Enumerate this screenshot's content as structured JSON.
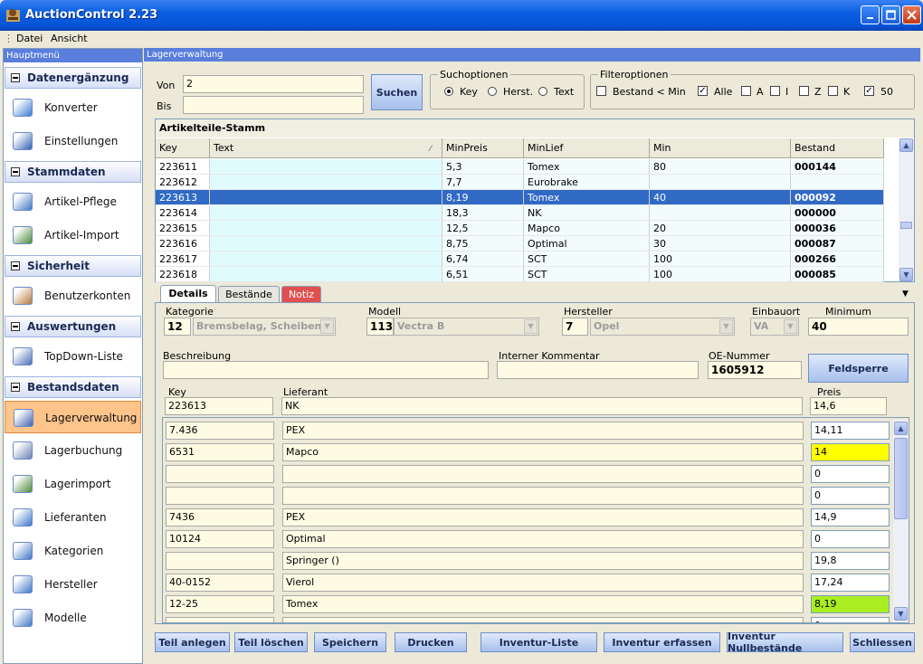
{
  "window": {
    "title": "AuctionControl 2.23"
  },
  "menu": [
    "Datei",
    "Ansicht"
  ],
  "sidebar": {
    "header": "Hauptmenü",
    "sections": [
      {
        "label": "Datenergänzung",
        "items": [
          {
            "label": "Konverter",
            "icon": "converter-icon"
          },
          {
            "label": "Einstellungen",
            "icon": "settings-icon"
          }
        ]
      },
      {
        "label": "Stammdaten",
        "items": [
          {
            "label": "Artikel-Pflege",
            "icon": "article-care-icon"
          },
          {
            "label": "Artikel-Import",
            "icon": "article-import-icon"
          }
        ]
      },
      {
        "label": "Sicherheit",
        "items": [
          {
            "label": "Benutzerkonten",
            "icon": "users-icon"
          }
        ]
      },
      {
        "label": "Auswertungen",
        "items": [
          {
            "label": "TopDown-Liste",
            "icon": "chart-icon"
          }
        ]
      },
      {
        "label": "Bestandsdaten",
        "items": [
          {
            "label": "Lagerverwaltung",
            "icon": "warehouse-icon",
            "selected": true
          },
          {
            "label": "Lagerbuchung",
            "icon": "booking-icon"
          },
          {
            "label": "Lagerimport",
            "icon": "import-icon"
          },
          {
            "label": "Lieferanten",
            "icon": "suppliers-icon"
          },
          {
            "label": "Kategorien",
            "icon": "categories-icon"
          },
          {
            "label": "Hersteller",
            "icon": "manufacturers-icon"
          },
          {
            "label": "Modelle",
            "icon": "models-icon"
          }
        ]
      }
    ]
  },
  "panel": {
    "header": "Lagerverwaltung"
  },
  "search": {
    "von_label": "Von",
    "von_value": "2",
    "bis_label": "Bis",
    "bis_value": "",
    "button": "Suchen"
  },
  "suchoptionen": {
    "title": "Suchoptionen",
    "options": [
      "Key",
      "Herst.",
      "Text"
    ],
    "selected": "Key"
  },
  "filteroptionen": {
    "title": "Filteroptionen",
    "bestand_label": "Bestand < Min",
    "bestand_checked": false,
    "items": [
      {
        "label": "Alle",
        "checked": true
      },
      {
        "label": "A",
        "checked": false
      },
      {
        "label": "I",
        "checked": false
      },
      {
        "label": "Z",
        "checked": false
      },
      {
        "label": "K",
        "checked": false
      },
      {
        "label": "50",
        "checked": true
      }
    ]
  },
  "grid": {
    "title": "Artikelteile-Stamm",
    "columns": [
      "Key",
      "Text",
      "MinPreis",
      "MinLief",
      "Min",
      "Bestand"
    ],
    "rows": [
      [
        "223611",
        "",
        "5,3",
        "Tomex",
        "80",
        "000144"
      ],
      [
        "223612",
        "",
        "7,7",
        "Eurobrake",
        "",
        ""
      ],
      [
        "223613",
        "",
        "8,19",
        "Tomex",
        "40",
        "000092"
      ],
      [
        "223614",
        "",
        "18,3",
        "NK",
        "",
        "000000"
      ],
      [
        "223615",
        "",
        "12,5",
        "Mapco",
        "20",
        "000036"
      ],
      [
        "223616",
        "",
        "8,75",
        "Optimal",
        "30",
        "000087"
      ],
      [
        "223617",
        "",
        "6,74",
        "SCT",
        "100",
        "000266"
      ],
      [
        "223618",
        "",
        "6,51",
        "SCT",
        "100",
        "000085"
      ]
    ],
    "selected_row": 2
  },
  "tabs": [
    "Details",
    "Bestände",
    "Notiz"
  ],
  "details": {
    "kategorie_label": "Kategorie",
    "kategorie_num": "12",
    "kategorie_value": "Bremsbelag, Scheibenbr",
    "modell_label": "Modell",
    "modell_num": "113",
    "modell_value": "Vectra B",
    "hersteller_label": "Hersteller",
    "hersteller_num": "7",
    "hersteller_value": "Opel",
    "einbauort_label": "Einbauort",
    "einbauort_value": "VA",
    "minimum_label": "Minimum",
    "minimum_value": "40",
    "beschreibung_label": "Beschreibung",
    "beschreibung_value": "",
    "kommentar_label": "Interner Kommentar",
    "kommentar_value": "",
    "oe_label": "OE-Nummer",
    "oe_value": "1605912",
    "feldsperre": "Feldsperre",
    "key_label": "Key",
    "key_value": "223613",
    "lieferant_label": "Lieferant",
    "lieferant_value": "NK",
    "preis_label": "Preis",
    "preis_value": "14,6"
  },
  "suppliers": [
    {
      "key": "7.436",
      "name": "PEX",
      "price": "14,11",
      "hl": ""
    },
    {
      "key": "6531",
      "name": "Mapco",
      "price": "14",
      "hl": "#ffff00"
    },
    {
      "key": "",
      "name": "",
      "price": "0",
      "hl": ""
    },
    {
      "key": "",
      "name": "",
      "price": "0",
      "hl": ""
    },
    {
      "key": "7436",
      "name": "PEX",
      "price": "14,9",
      "hl": ""
    },
    {
      "key": "10124",
      "name": "Optimal",
      "price": "0",
      "hl": ""
    },
    {
      "key": "",
      "name": "Springer ()",
      "price": "19,8",
      "hl": ""
    },
    {
      "key": "40-0152",
      "name": "Vierol",
      "price": "17,24",
      "hl": ""
    },
    {
      "key": "12-25",
      "name": "Tomex",
      "price": "8,19",
      "hl": "#aaee22"
    },
    {
      "key": "",
      "name": "",
      "price": "0",
      "hl": ""
    }
  ],
  "buttons": [
    "Teil anlegen",
    "Teil löschen",
    "Speichern",
    "Drucken",
    "Inventur-Liste",
    "Inventur erfassen",
    "Inventur Nullbestände",
    "Schliessen"
  ]
}
